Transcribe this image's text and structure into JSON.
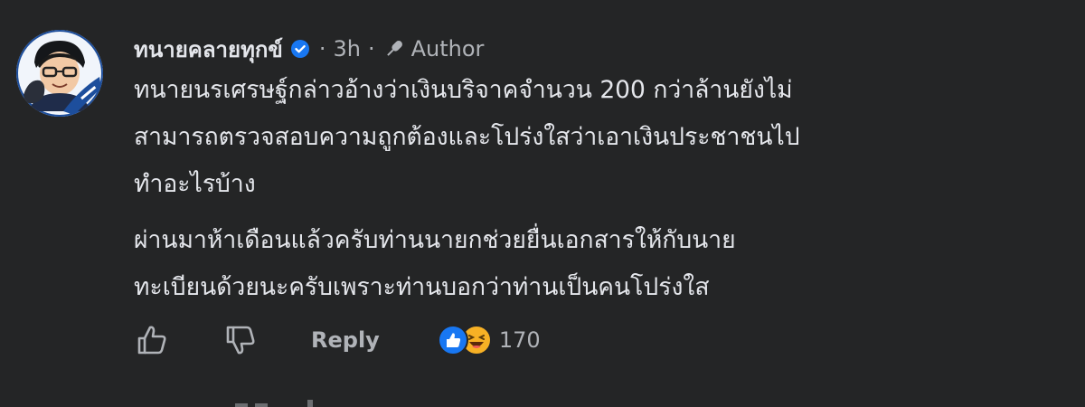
{
  "comment": {
    "author": "ทนายคลายทุกข์",
    "verified_icon": "verified-badge-icon",
    "separator": "·",
    "time": "3h",
    "separator2": "·",
    "author_badge": "Author",
    "paragraphs": [
      {
        "lines": [
          "ทนายนรเศรษฐ์กล่าวอ้างว่าเงินบริจาคจำนวน 200 กว่าล้านยังไม่",
          "สามารถตรวจสอบความถูกต้องและโปร่งใสว่าเอาเงินประชาชนไป",
          "ทำอะไรบ้าง"
        ]
      },
      {
        "lines": [
          "ผ่านมาห้าเดือนแล้วครับท่านนายกช่วยยื่นเอกสารให้กับนาย",
          "ทะเบียนด้วยนะครับเพราะท่านบอกว่าท่านเป็นคนโปร่งใส"
        ]
      }
    ]
  },
  "actions": {
    "reply_label": "Reply",
    "reaction_count": "170",
    "reaction_icons": [
      "like-reaction-icon",
      "haha-reaction-icon"
    ]
  },
  "colors": {
    "background": "#242526",
    "text": "#e4e6eb",
    "secondary": "#b0b3b8",
    "verified": "#1877f2"
  }
}
